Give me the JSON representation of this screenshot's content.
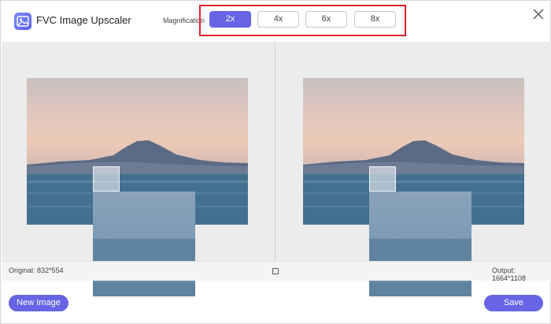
{
  "app": {
    "title": "FVC Image Upscaler",
    "icon": "image-upscaler-logo-icon",
    "accent_color": "#6764e6"
  },
  "magnification": {
    "label": "Magnification",
    "options": [
      "2x",
      "4x",
      "6x",
      "8x"
    ],
    "selected": "2x",
    "highlight_color": "#d9252b"
  },
  "preview": {
    "original_size_label": "Original: 832*554",
    "output_size_label": "Output: 1664*1108"
  },
  "actions": {
    "new_image_label": "New Image",
    "save_label": "Save"
  },
  "icons": {
    "close": "close-icon",
    "compare": "compare-toggle-icon"
  }
}
